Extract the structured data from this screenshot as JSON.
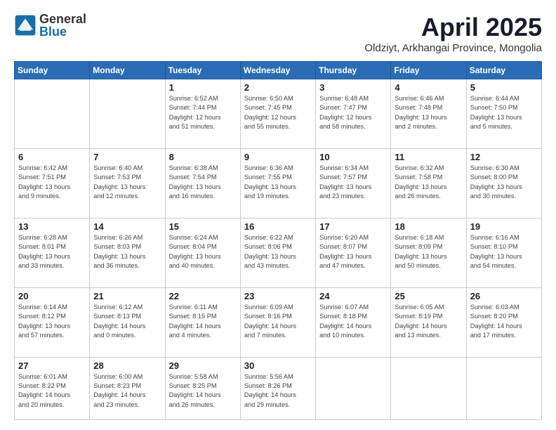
{
  "logo": {
    "general": "General",
    "blue": "Blue"
  },
  "header": {
    "title": "April 2025",
    "subtitle": "Oldziyt, Arkhangai Province, Mongolia"
  },
  "weekdays": [
    "Sunday",
    "Monday",
    "Tuesday",
    "Wednesday",
    "Thursday",
    "Friday",
    "Saturday"
  ],
  "weeks": [
    [
      {
        "day": "",
        "info": ""
      },
      {
        "day": "",
        "info": ""
      },
      {
        "day": "1",
        "info": "Sunrise: 6:52 AM\nSunset: 7:44 PM\nDaylight: 12 hours\nand 51 minutes."
      },
      {
        "day": "2",
        "info": "Sunrise: 6:50 AM\nSunset: 7:45 PM\nDaylight: 12 hours\nand 55 minutes."
      },
      {
        "day": "3",
        "info": "Sunrise: 6:48 AM\nSunset: 7:47 PM\nDaylight: 12 hours\nand 58 minutes."
      },
      {
        "day": "4",
        "info": "Sunrise: 6:46 AM\nSunset: 7:48 PM\nDaylight: 13 hours\nand 2 minutes."
      },
      {
        "day": "5",
        "info": "Sunrise: 6:44 AM\nSunset: 7:50 PM\nDaylight: 13 hours\nand 5 minutes."
      }
    ],
    [
      {
        "day": "6",
        "info": "Sunrise: 6:42 AM\nSunset: 7:51 PM\nDaylight: 13 hours\nand 9 minutes."
      },
      {
        "day": "7",
        "info": "Sunrise: 6:40 AM\nSunset: 7:53 PM\nDaylight: 13 hours\nand 12 minutes."
      },
      {
        "day": "8",
        "info": "Sunrise: 6:38 AM\nSunset: 7:54 PM\nDaylight: 13 hours\nand 16 minutes."
      },
      {
        "day": "9",
        "info": "Sunrise: 6:36 AM\nSunset: 7:55 PM\nDaylight: 13 hours\nand 19 minutes."
      },
      {
        "day": "10",
        "info": "Sunrise: 6:34 AM\nSunset: 7:57 PM\nDaylight: 13 hours\nand 23 minutes."
      },
      {
        "day": "11",
        "info": "Sunrise: 6:32 AM\nSunset: 7:58 PM\nDaylight: 13 hours\nand 26 minutes."
      },
      {
        "day": "12",
        "info": "Sunrise: 6:30 AM\nSunset: 8:00 PM\nDaylight: 13 hours\nand 30 minutes."
      }
    ],
    [
      {
        "day": "13",
        "info": "Sunrise: 6:28 AM\nSunset: 8:01 PM\nDaylight: 13 hours\nand 33 minutes."
      },
      {
        "day": "14",
        "info": "Sunrise: 6:26 AM\nSunset: 8:03 PM\nDaylight: 13 hours\nand 36 minutes."
      },
      {
        "day": "15",
        "info": "Sunrise: 6:24 AM\nSunset: 8:04 PM\nDaylight: 13 hours\nand 40 minutes."
      },
      {
        "day": "16",
        "info": "Sunrise: 6:22 AM\nSunset: 8:06 PM\nDaylight: 13 hours\nand 43 minutes."
      },
      {
        "day": "17",
        "info": "Sunrise: 6:20 AM\nSunset: 8:07 PM\nDaylight: 13 hours\nand 47 minutes."
      },
      {
        "day": "18",
        "info": "Sunrise: 6:18 AM\nSunset: 8:09 PM\nDaylight: 13 hours\nand 50 minutes."
      },
      {
        "day": "19",
        "info": "Sunrise: 6:16 AM\nSunset: 8:10 PM\nDaylight: 13 hours\nand 54 minutes."
      }
    ],
    [
      {
        "day": "20",
        "info": "Sunrise: 6:14 AM\nSunset: 8:12 PM\nDaylight: 13 hours\nand 57 minutes."
      },
      {
        "day": "21",
        "info": "Sunrise: 6:12 AM\nSunset: 8:13 PM\nDaylight: 14 hours\nand 0 minutes."
      },
      {
        "day": "22",
        "info": "Sunrise: 6:11 AM\nSunset: 8:15 PM\nDaylight: 14 hours\nand 4 minutes."
      },
      {
        "day": "23",
        "info": "Sunrise: 6:09 AM\nSunset: 8:16 PM\nDaylight: 14 hours\nand 7 minutes."
      },
      {
        "day": "24",
        "info": "Sunrise: 6:07 AM\nSunset: 8:18 PM\nDaylight: 14 hours\nand 10 minutes."
      },
      {
        "day": "25",
        "info": "Sunrise: 6:05 AM\nSunset: 8:19 PM\nDaylight: 14 hours\nand 13 minutes."
      },
      {
        "day": "26",
        "info": "Sunrise: 6:03 AM\nSunset: 8:20 PM\nDaylight: 14 hours\nand 17 minutes."
      }
    ],
    [
      {
        "day": "27",
        "info": "Sunrise: 6:01 AM\nSunset: 8:22 PM\nDaylight: 14 hours\nand 20 minutes."
      },
      {
        "day": "28",
        "info": "Sunrise: 6:00 AM\nSunset: 8:23 PM\nDaylight: 14 hours\nand 23 minutes."
      },
      {
        "day": "29",
        "info": "Sunrise: 5:58 AM\nSunset: 8:25 PM\nDaylight: 14 hours\nand 26 minutes."
      },
      {
        "day": "30",
        "info": "Sunrise: 5:56 AM\nSunset: 8:26 PM\nDaylight: 14 hours\nand 29 minutes."
      },
      {
        "day": "",
        "info": ""
      },
      {
        "day": "",
        "info": ""
      },
      {
        "day": "",
        "info": ""
      }
    ]
  ]
}
